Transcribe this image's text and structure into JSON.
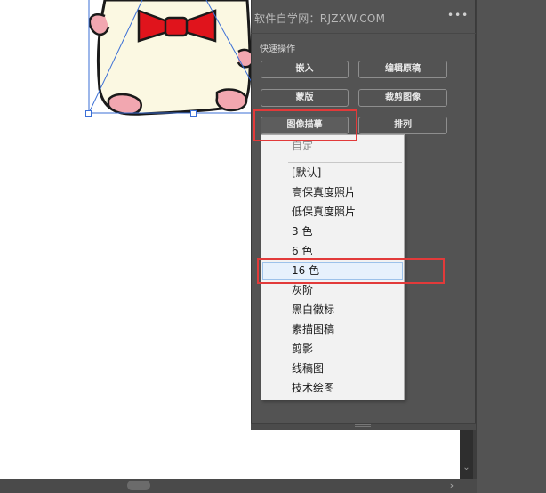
{
  "panel": {
    "watermark": "软件自学网：RJZXW.COM",
    "more_icon": "•••",
    "section_title": "快速操作",
    "buttons": {
      "embed": "嵌入",
      "edit_original": "编辑原稿",
      "mask": "蒙版",
      "crop_image": "裁剪图像",
      "image_trace": "图像描摹",
      "arrange": "排列"
    }
  },
  "dropdown": {
    "items": [
      "自定",
      "[默认]",
      "高保真度照片",
      "低保真度照片",
      "3 色",
      "6 色",
      "16 色",
      "灰阶",
      "黑白徽标",
      "素描图稿",
      "剪影",
      "线稿图",
      "技术绘图"
    ],
    "disabled_item": "自定",
    "highlighted_item": "16 色"
  },
  "icons": {
    "scroll_down": "chevron-down-icon",
    "scroll_right": "chevron-right-icon",
    "more": "more-options-icon"
  },
  "scroll_arrows": {
    "down": "⌄",
    "right": "›"
  },
  "colors": {
    "panel_bg": "#535353",
    "annotation": "#e23a3a",
    "selection": "#3b6fd6",
    "bow_tie": "#e0141c",
    "character_body": "#fbf8e2",
    "character_pink": "#f2a7b0"
  }
}
